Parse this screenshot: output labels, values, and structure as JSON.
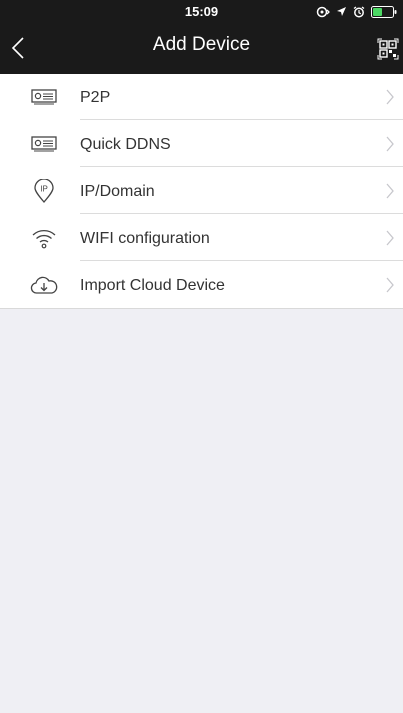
{
  "status_bar": {
    "time": "15:09"
  },
  "nav": {
    "title": "Add Device"
  },
  "menu": [
    {
      "label": "P2P",
      "icon": "device-box-icon"
    },
    {
      "label": "Quick DDNS",
      "icon": "device-box-icon"
    },
    {
      "label": "IP/Domain",
      "icon": "ip-pin-icon"
    },
    {
      "label": "WIFI configuration",
      "icon": "wifi-icon"
    },
    {
      "label": "Import Cloud Device",
      "icon": "cloud-download-icon"
    }
  ],
  "colors": {
    "header_bg": "#1a1a1a",
    "page_bg": "#efeff4",
    "battery_green": "#4cd964",
    "chevron": "#c7c7cc"
  }
}
